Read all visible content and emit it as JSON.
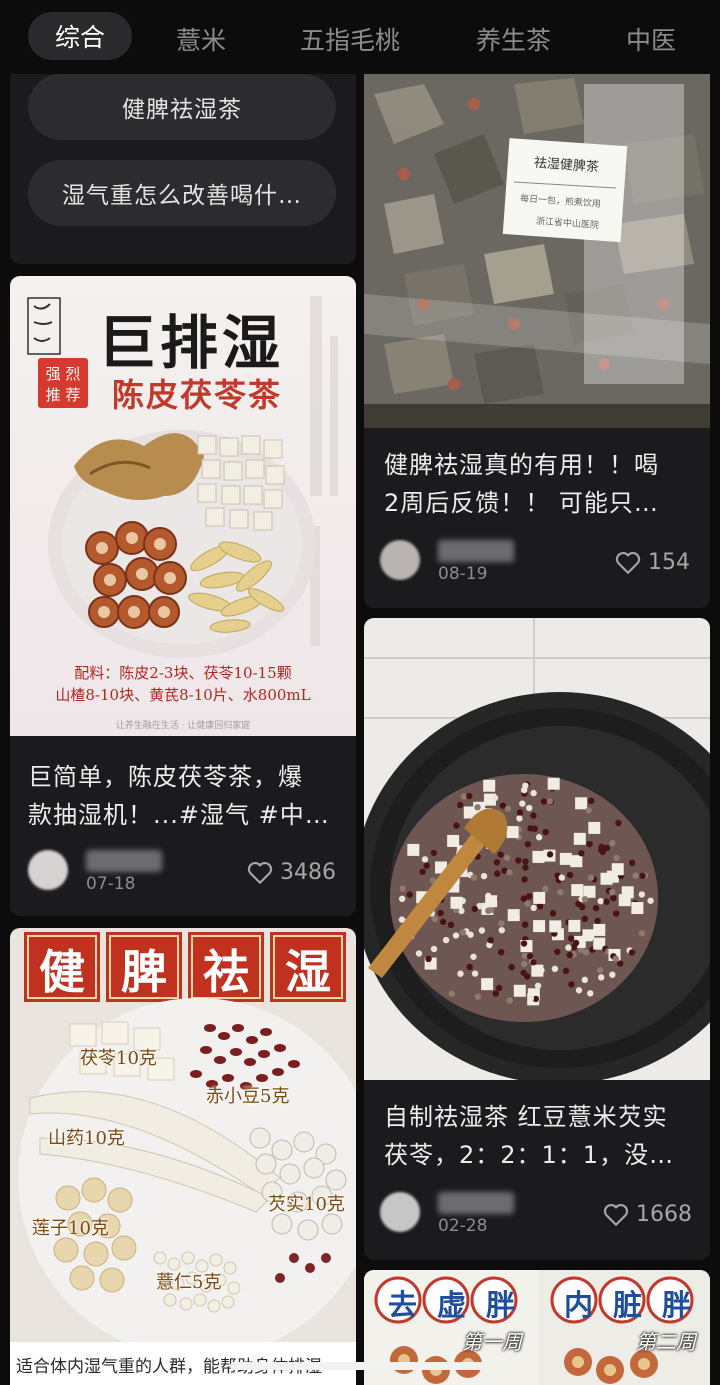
{
  "tabs": [
    {
      "label": "综合"
    },
    {
      "label": "薏米"
    },
    {
      "label": "五指毛桃"
    },
    {
      "label": "养生茶"
    },
    {
      "label": "中医"
    }
  ],
  "related_searches": [
    "健脾祛湿茶",
    "湿气重怎么改善喝什…"
  ],
  "posts": {
    "chenpi": {
      "title": "巨简单，陈皮茯苓茶，爆款抽湿机！...#湿气 #中…",
      "title_line1": "巨简单，陈皮茯苓茶，爆",
      "title_line2": "款抽湿机！...#湿气 #中…",
      "date": "07-18",
      "likes": "3486",
      "image": {
        "headline": "巨排湿",
        "subtitle": "陈皮茯苓茶",
        "seal_text": "强烈推荐",
        "recipe_line1": "配料：陈皮2-3块、茯苓10-15颗",
        "recipe_line2": "山楂8-10块、黄芪8-10片、水800mL",
        "footer": "让养生融在生活 · 让健康回归家庭"
      }
    },
    "bag": {
      "title_line1": "健脾祛湿真的有用！！喝",
      "title_line2": "2周后反馈！！ 可能只…",
      "date": "08-19",
      "likes": "154",
      "image": {
        "label_title": "祛湿健脾茶",
        "label_line": "每日一包，煎煮饮用",
        "label_footer": "浙江省中山医院"
      }
    },
    "wok": {
      "title_line1": "自制祛湿茶 红豆薏米芡实",
      "title_line2": "茯苓，2：2：1：1，没…",
      "date": "02-28",
      "likes": "1668"
    },
    "spleen": {
      "caption": "适合体内湿气重的人群，能帮助身体排湿",
      "image": {
        "banner": [
          "健",
          "脾",
          "祛",
          "湿"
        ],
        "labels": [
          "茯苓10克",
          "赤小豆5克",
          "山药10克",
          "芡实10克",
          "莲子10克",
          "薏仁5克"
        ]
      }
    },
    "bottom": {
      "left_title": "去虚胖",
      "left_week": "第一周",
      "right_title": "内脏胖",
      "right_week": "第二周"
    }
  },
  "colors": {
    "background": "#0c0c0c",
    "card": "#1b1b1d",
    "chip": "#2c2c2e",
    "accent_red": "#c0392b"
  }
}
